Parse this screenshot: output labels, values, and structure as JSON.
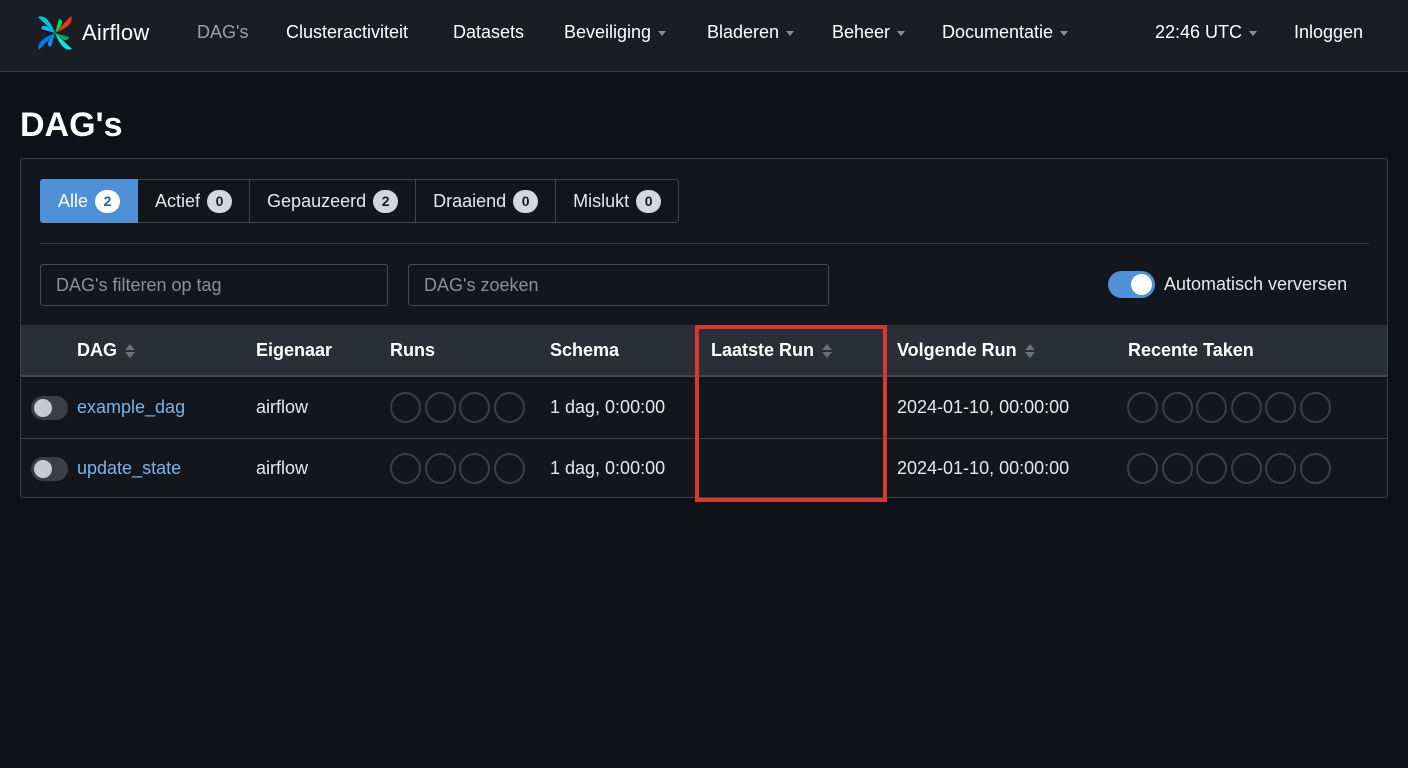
{
  "brand": {
    "name": "Airflow",
    "logo_icon": "airflow-pinwheel-icon"
  },
  "nav": {
    "dags": "DAG's",
    "cluster": "Clusteractiviteit",
    "datasets": "Datasets",
    "security": "Beveiliging",
    "browse": "Bladeren",
    "admin": "Beheer",
    "docs": "Documentatie",
    "time": "22:46 UTC",
    "login": "Inloggen"
  },
  "page_title": "DAG's",
  "tabs": [
    {
      "label": "Alle",
      "count": "2"
    },
    {
      "label": "Actief",
      "count": "0"
    },
    {
      "label": "Gepauzeerd",
      "count": "2"
    },
    {
      "label": "Draaiend",
      "count": "0"
    },
    {
      "label": "Mislukt",
      "count": "0"
    }
  ],
  "filters": {
    "tag_placeholder": "DAG's filteren op tag",
    "search_placeholder": "DAG's zoeken",
    "auto_refresh": "Automatisch verversen"
  },
  "table": {
    "headers": {
      "dag": "DAG",
      "owner": "Eigenaar",
      "runs": "Runs",
      "schedule": "Schema",
      "last_run": "Laatste Run",
      "next_run": "Volgende Run",
      "recent_tasks": "Recente Taken"
    },
    "rows": [
      {
        "dag": "example_dag",
        "owner": "airflow",
        "schedule": "1 dag, 0:00:00",
        "last_run": "",
        "next_run": "2024-01-10, 00:00:00"
      },
      {
        "dag": "update_state",
        "owner": "airflow",
        "schedule": "1 dag, 0:00:00",
        "last_run": "",
        "next_run": "2024-01-10, 00:00:00"
      }
    ]
  },
  "colors": {
    "accent": "#4f90d6",
    "highlight": "#d63a2c",
    "link": "#7ab4e8",
    "background": "#0e1117"
  }
}
